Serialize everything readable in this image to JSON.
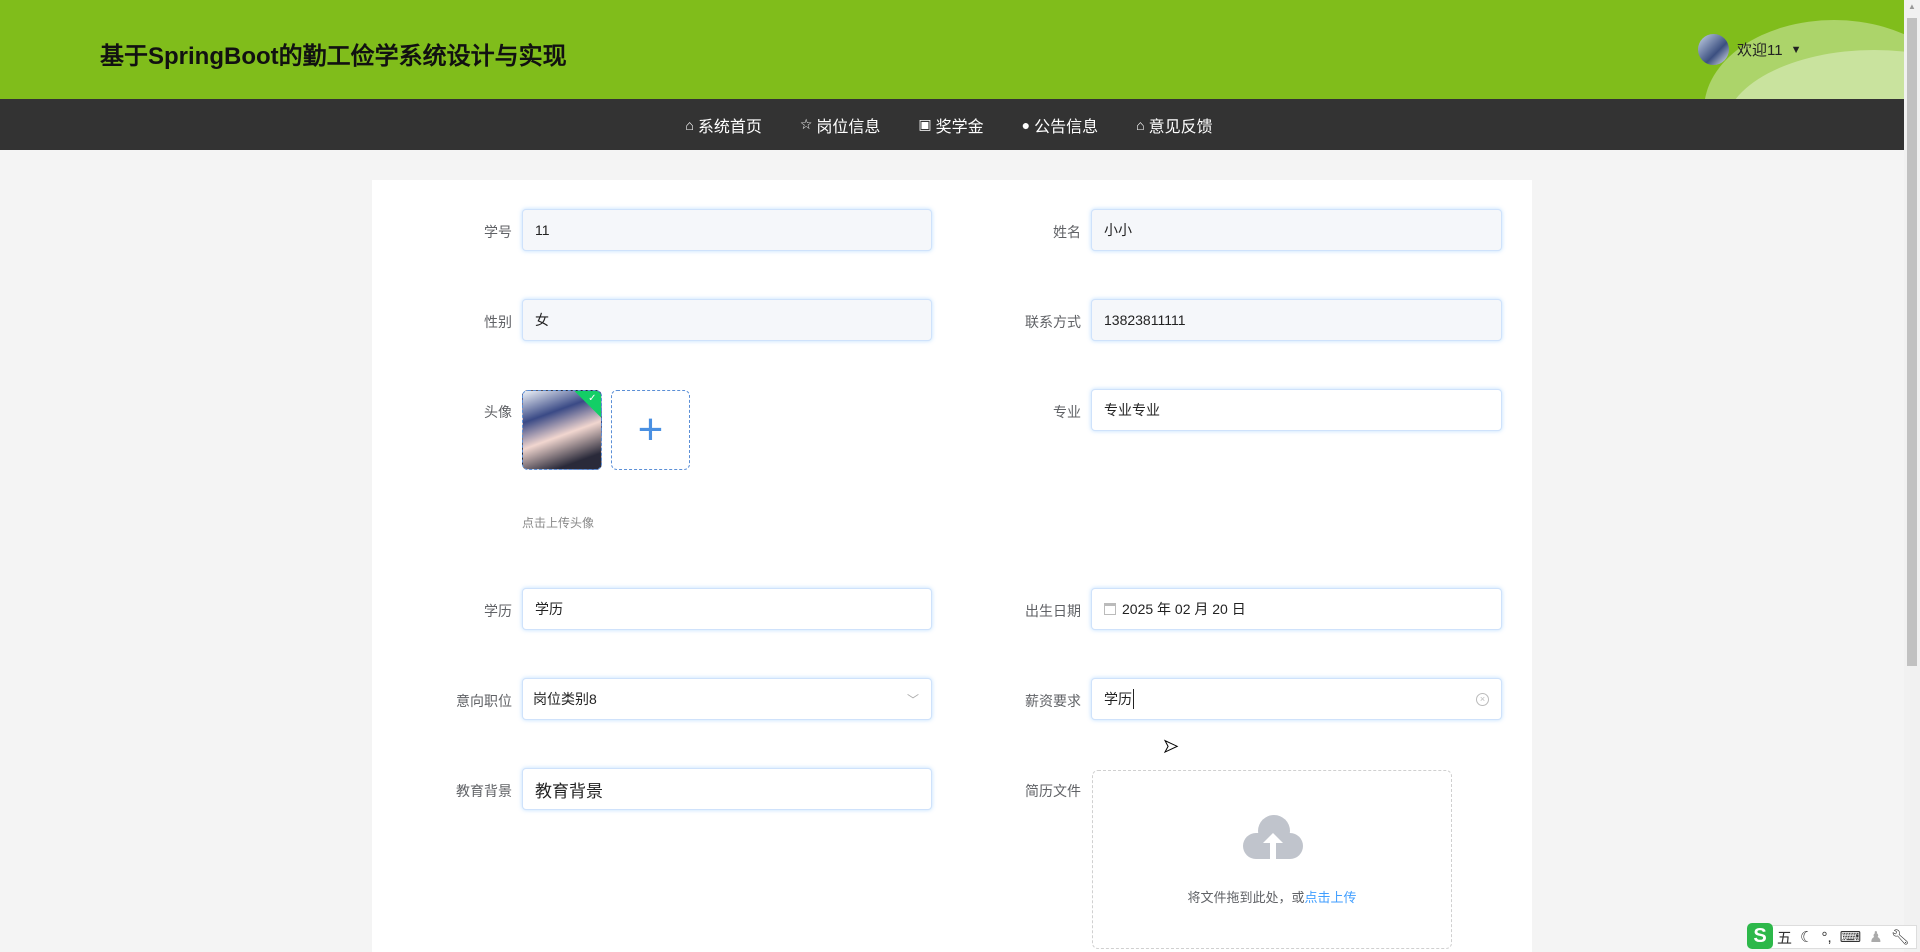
{
  "header": {
    "title": "基于SpringBoot的勤工俭学系统设计与实现",
    "user_greeting": "欢迎11"
  },
  "nav": [
    {
      "label": "系统首页",
      "icon": "home-icon"
    },
    {
      "label": "岗位信息",
      "icon": "star-icon"
    },
    {
      "label": "奖学金",
      "icon": "bag-icon"
    },
    {
      "label": "公告信息",
      "icon": "warning-icon"
    },
    {
      "label": "意见反馈",
      "icon": "home-icon"
    }
  ],
  "form": {
    "student_id": {
      "label": "学号",
      "value": "11"
    },
    "name": {
      "label": "姓名",
      "value": "小小"
    },
    "gender": {
      "label": "性别",
      "value": "女"
    },
    "phone": {
      "label": "联系方式",
      "value": "13823811111"
    },
    "avatar": {
      "label": "头像",
      "hint": "点击上传头像"
    },
    "major": {
      "label": "专业",
      "value": "专业专业"
    },
    "education": {
      "label": "学历",
      "value": "学历"
    },
    "birthday": {
      "label": "出生日期",
      "value": "2025 年 02 月 20 日"
    },
    "position": {
      "label": "意向职位",
      "value": "岗位类别8"
    },
    "salary": {
      "label": "薪资要求",
      "value": "学历"
    },
    "edu_background": {
      "label": "教育背景",
      "value": "教育背景"
    },
    "resume": {
      "label": "简历文件",
      "drop_text": "将文件拖到此处，或",
      "click_text": "点击上传"
    }
  },
  "ime": {
    "mode": "五"
  }
}
